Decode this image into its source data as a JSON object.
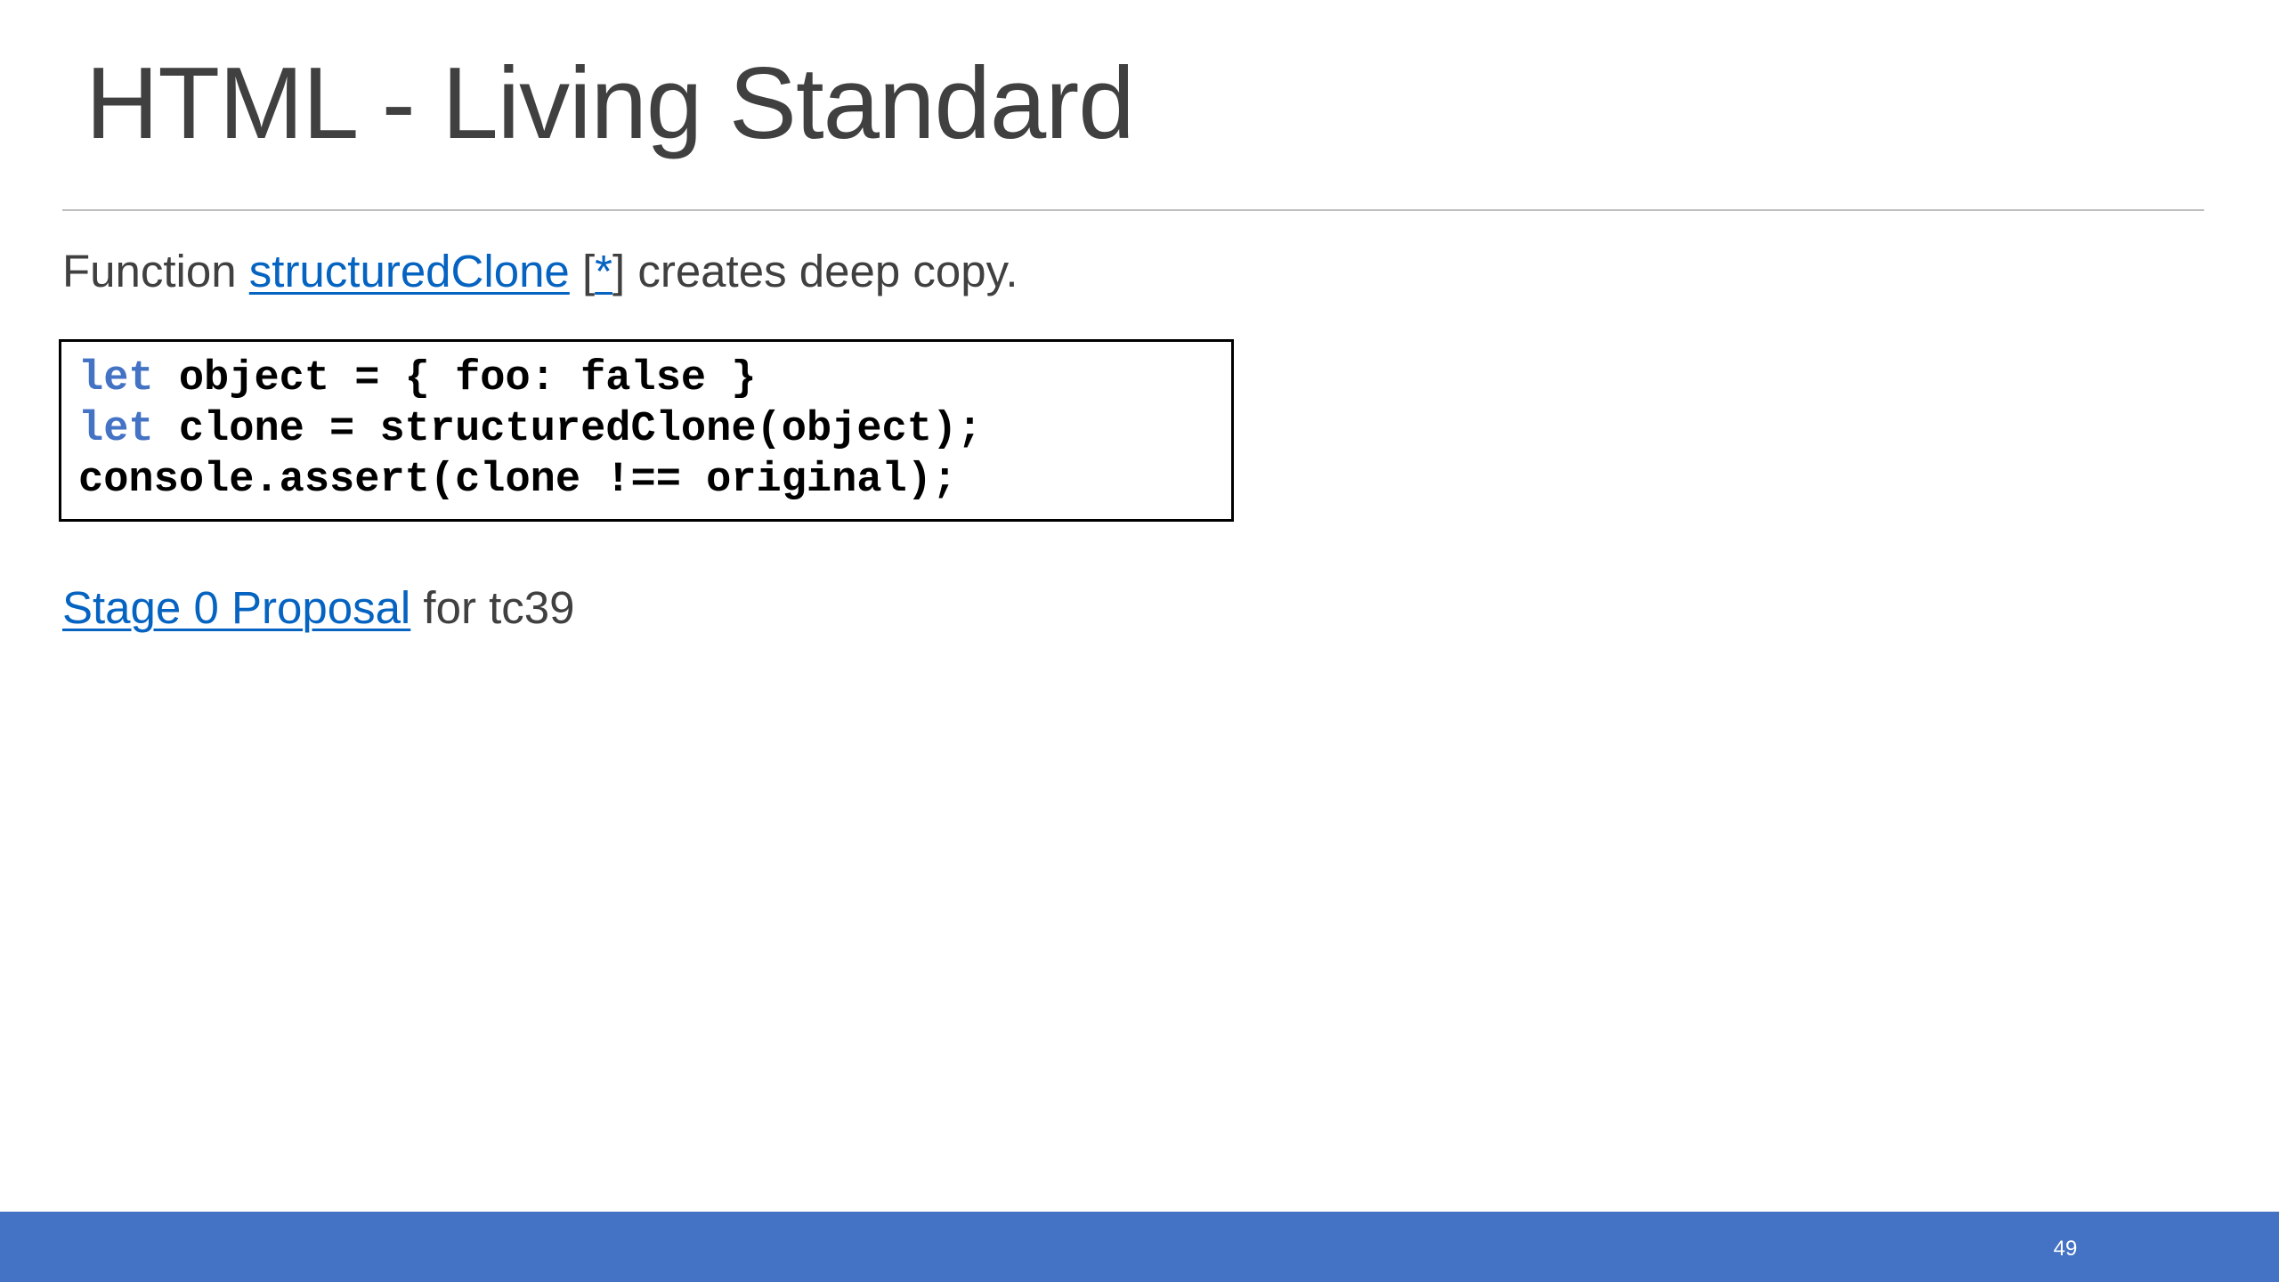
{
  "slide": {
    "title": "HTML - Living Standard",
    "line1": {
      "prefix": "Function ",
      "link_text": "structuredClone",
      "bracket_open": " [",
      "ref_link_text": "*",
      "suffix": "] creates deep copy."
    },
    "code": {
      "lines": [
        {
          "keyword": "let",
          "rest": " object = { foo: false }"
        },
        {
          "keyword": "let",
          "rest": " clone = structuredClone(object);"
        },
        {
          "keyword": "",
          "rest": "console.assert(clone !== original);"
        }
      ]
    },
    "line2": {
      "link_text": "Stage 0 Proposal",
      "suffix": " for tc39"
    },
    "page_number": "49"
  },
  "colors": {
    "title_text": "#404040",
    "body_text": "#404040",
    "link": "#0563c1",
    "keyword": "#4472c4",
    "footer_bar": "#4472c4",
    "rule": "#bfbfbf"
  }
}
